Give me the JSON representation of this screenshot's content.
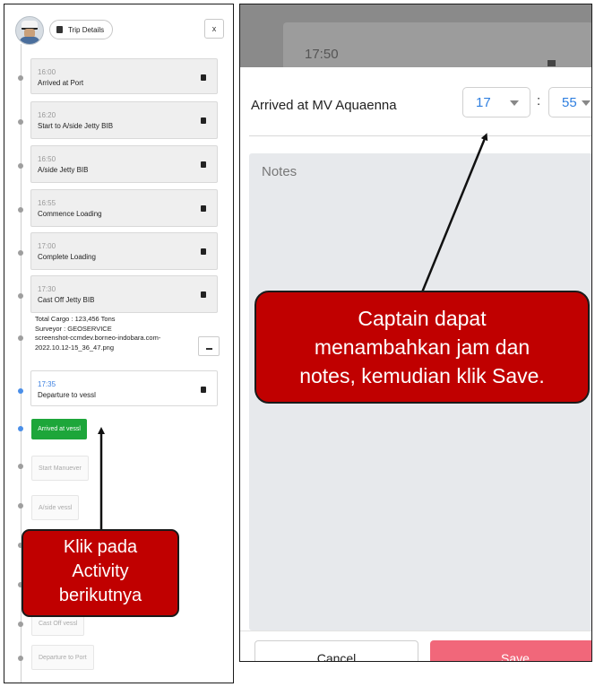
{
  "left_panel": {
    "header": {
      "trip_details_label": "Trip Details",
      "close_label": "x"
    },
    "completed_activities": [
      {
        "time": "16:00",
        "label": "Arrived at Port"
      },
      {
        "time": "16:20",
        "label": "Start to A/side Jetty BIB"
      },
      {
        "time": "16:50",
        "label": "A/side Jetty BIB"
      },
      {
        "time": "16:55",
        "label": "Commence Loading"
      },
      {
        "time": "17:00",
        "label": "Complete Loading"
      },
      {
        "time": "17:30",
        "label": "Cast Off Jetty BIB"
      }
    ],
    "summary": {
      "cargo": "Total Cargo : 123,456 Tons",
      "surveyor": "Surveyor : GEOSERVICE",
      "file": "screenshot-ccmdev.borneo-indobara.com-2022.10.12-15_36_47.png"
    },
    "current_activity": {
      "time": "17:35",
      "label": "Departure to vessl"
    },
    "next_button_label": "Arrived at vessl",
    "pending_activities": [
      "Start Manuever",
      "A/side vessl",
      "",
      "",
      "Cast Off vessl",
      "Departure to Port"
    ]
  },
  "callout_left": {
    "lines": [
      "Klik pada",
      "Activity",
      "berikutnya"
    ]
  },
  "right_panel": {
    "background_time": "17:50",
    "activity_label": "Arrived at MV Aquaenna",
    "hour_value": "17",
    "minute_value": "55",
    "separator": ":",
    "notes_placeholder": "Notes",
    "cancel_label": "Cancel",
    "save_label": "Save"
  },
  "callout_right": {
    "lines": [
      "Captain dapat",
      "menambahkan jam dan",
      "notes, kemudian klik Save."
    ]
  },
  "colors": {
    "callout": "#c00000",
    "green": "#1da63a",
    "save": "#f1677a",
    "accent": "#2f7fe0"
  }
}
